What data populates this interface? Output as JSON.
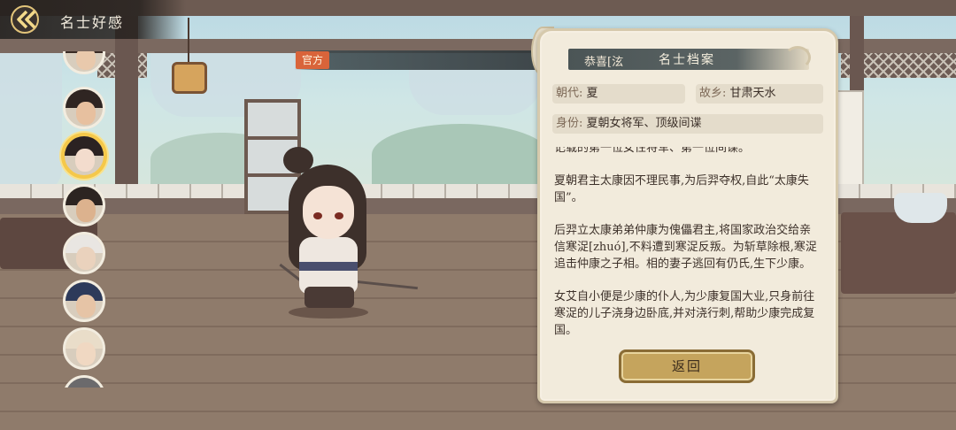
{
  "header": {
    "title": "名士好感"
  },
  "tag": {
    "official": "官方",
    "congrats_text": "恭喜[泫"
  },
  "panel": {
    "title": "名士档案",
    "dynasty": {
      "label": "朝代:",
      "value": "夏"
    },
    "hometown": {
      "label": "故乡:",
      "value": "甘肃天水"
    },
    "identity": {
      "label": "身份:",
      "value": "夏朝女将军、顶级间谍"
    },
    "description": [
      "记载的第一位女性将军、第一位间谍。",
      "夏朝君主太康因不理民事,为后羿夺权,自此“太康失国”。",
      "后羿立太康弟弟仲康为傀儡君主,将国家政治交给亲信寒浞[zhuó],不料遭到寒浞反叛。为斩草除根,寒浞追击仲康之子相。相的妻子逃回有仍氏,生下少康。",
      "女艾自小便是少康的仆人,为少康复国大业,只身前往寒浞的儿子浇身边卧底,并对浇行刺,帮助少康完成复国。"
    ],
    "return_label": "返回"
  },
  "avatars": [
    {
      "id": "scholar-top",
      "hair": "#3a2b25",
      "skin": "#e9c9ac"
    },
    {
      "id": "warrior-1",
      "hair": "#2f2522",
      "skin": "#e7c09f"
    },
    {
      "id": "nu-ai",
      "hair": "#2b2222",
      "skin": "#f3dccd",
      "selected": true
    },
    {
      "id": "warrior-2",
      "hair": "#2c2421",
      "skin": "#dcb28e"
    },
    {
      "id": "elder-white",
      "hair": "#e9e6e2",
      "skin": "#ead2bd"
    },
    {
      "id": "official-hat",
      "hair": "#2d3a5a",
      "skin": "#e6c4a6"
    },
    {
      "id": "monk",
      "hair": "#e9ddc9",
      "skin": "#f0d8c2"
    },
    {
      "id": "partial",
      "hair": "#6b6a6c",
      "skin": "#d9c7b8"
    }
  ],
  "colors": {
    "panel_bg": "#f2ebdc",
    "accent_gold": "#c5a45d",
    "selected_ring": "#f5c84a",
    "official_tag": "#d9643a"
  },
  "icons": {
    "back": "double-chevron-left-icon"
  }
}
